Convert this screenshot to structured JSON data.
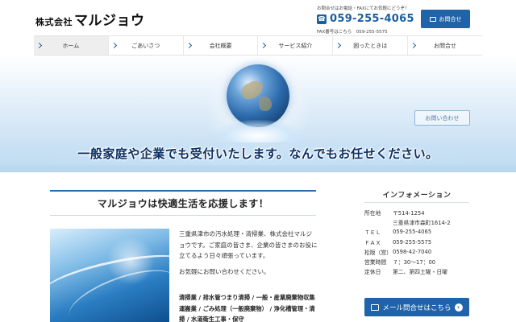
{
  "logo": {
    "prefix": "株式会社",
    "name": "マルジョウ"
  },
  "contact": {
    "note": "お問合せはお電話・FAXにてお気軽にどうぞ！",
    "tel": "059-255-4065",
    "fax": "FAX番号はこちら　059-255-5575"
  },
  "header_button": "お問合せ",
  "nav": [
    "ホーム",
    "ごあいさつ",
    "会社概要",
    "サービス紹介",
    "困ったときは",
    "お問合せ"
  ],
  "hero": {
    "contact_button": "お問い合わせ",
    "catch": "一般家庭や企業でも受付いたします。なんでもお任せください。"
  },
  "main": {
    "title": "マルジョウは快適生活を応援します！",
    "paragraph1": "三重県津市の汚水処理・清掃業、株式会社マルジョウです。ご家庭の皆さま、企業の皆さまのお役に立てるよう日々頑張っています。",
    "paragraph2": "お気軽にお問い合わせください。",
    "services": "清掃業 / 排水管つまり清掃 / 一般・産業廃棄物収集運搬業 / ごみ処理（一般廃棄物） / 浄化槽管理・清掃 / 水道衛生工事・保守"
  },
  "info": {
    "title": "インフォメーション",
    "rows": [
      {
        "k": "所在地",
        "v": "〒514-1254"
      },
      {
        "k": "",
        "v": "三重県津市森町1614-2"
      },
      {
        "k": "ＴＥＬ",
        "v": "059-255-4065"
      },
      {
        "k": "ＦＡＸ",
        "v": "059-255-5575"
      },
      {
        "k": "松阪（営）",
        "v": "0598-42-7040"
      },
      {
        "k": "営業時間",
        "v": "７：30〜17：00"
      },
      {
        "k": "定休日",
        "v": "第二、第四土曜・日曜"
      }
    ],
    "mail_button": "メール問合せはこちら"
  }
}
